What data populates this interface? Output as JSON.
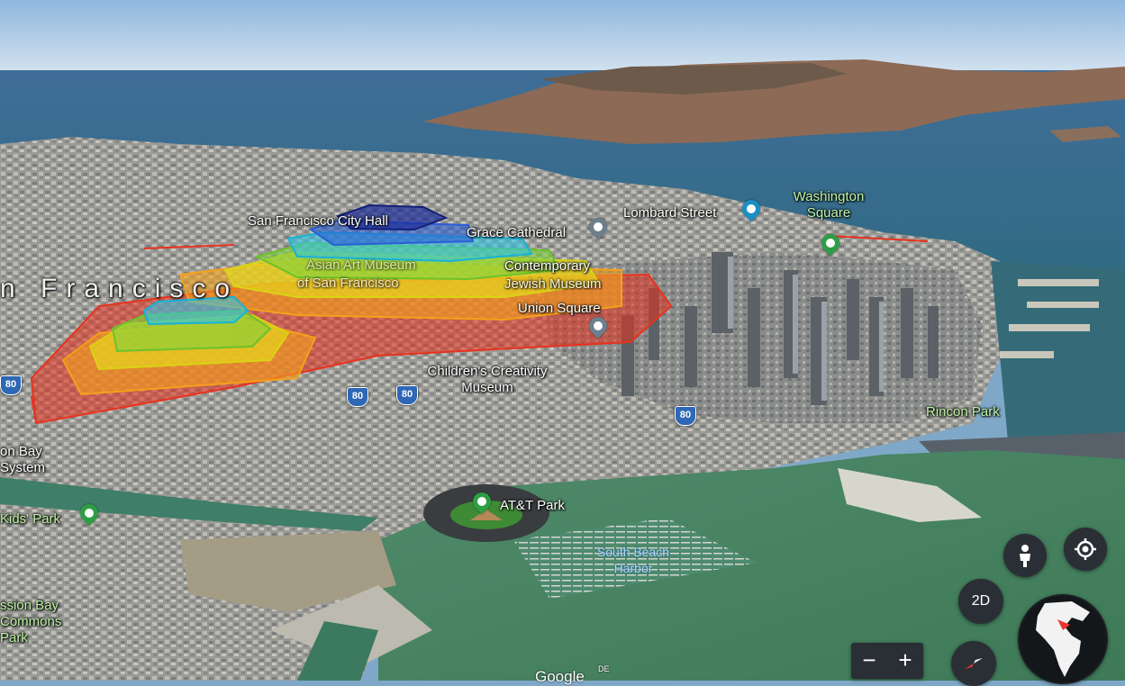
{
  "map": {
    "view": "3D satellite",
    "city_label": "n Francisco",
    "labels": {
      "city_hall": "San Francisco City Hall",
      "grace_cathedral": "Grace Cathedral",
      "lombard_street": "Lombard Street",
      "washington_square": "Washington Square",
      "contemporary": "Contemporary",
      "jewish_museum": "Jewish Museum",
      "asian_museum": "Asian Art Museum",
      "of_san_francisco": "of San Francisco",
      "union_square": "Union Square",
      "childrens_museum": "Children's Creativity Museum",
      "rincon_park": "Rincon Park",
      "bay_system": "on Bay System",
      "kids_park": "Kids' Park",
      "mission_bay_commons": "ssion Bay Commons Park",
      "att_park": "AT&T Park",
      "south_beach_harbor": "South Beach Harbor"
    },
    "highway_shields": [
      "80",
      "80",
      "80",
      "80"
    ],
    "accent_colors": {
      "ring_red": "#e8321e",
      "ring_orange": "#f5a11a",
      "ring_yellow": "#e6e21a",
      "ring_green": "#7ed33a",
      "ring_cyan": "#2ec6e6",
      "ring_blue": "#2a5fd6",
      "ring_navy": "#1c2c9a",
      "park_pin": "#2e9e45",
      "attraction_pin": "#1a8fc6",
      "place_pin": "#6d7e8c"
    }
  },
  "controls": {
    "pegman_icon": "pegman-icon",
    "locate_icon": "my-location-icon",
    "mode_2d_label": "2D",
    "zoom_out_label": "−",
    "zoom_in_label": "+",
    "compass_icon": "compass-icon",
    "globe_icon": "globe-icon"
  },
  "attribution": {
    "brand": "Google",
    "region": "DE"
  }
}
